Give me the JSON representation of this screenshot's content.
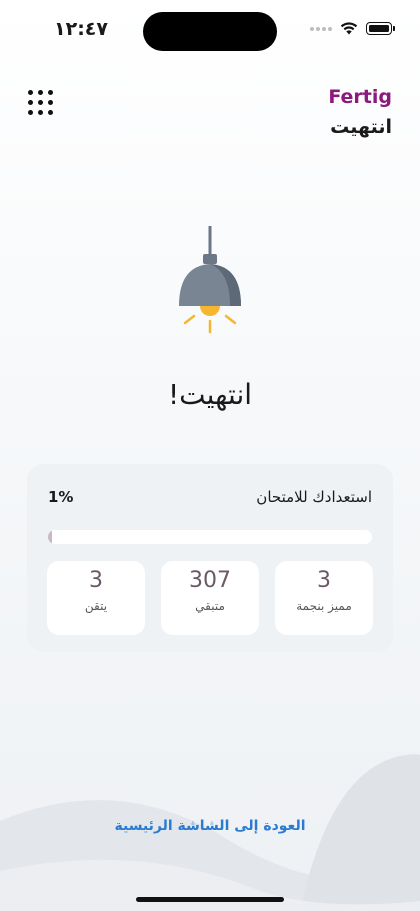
{
  "status_bar": {
    "time": "١٢:٤٧"
  },
  "header": {
    "brand": "Fertig",
    "title": "انتهيت"
  },
  "icons": {
    "menu": "grid-dots-icon",
    "illustration": "hanging-lamp-icon"
  },
  "main": {
    "title": "انتهيت!"
  },
  "readiness": {
    "label": "استعدادك للامتحان",
    "value_text": "1%",
    "progress": 0.01
  },
  "stats": [
    {
      "value": "3",
      "label": "مميز بنجمة"
    },
    {
      "value": "307",
      "label": "متبقي"
    },
    {
      "value": "3",
      "label": "يتقن"
    }
  ],
  "footer": {
    "home_link": "العودة إلى الشاشة الرئيسية"
  },
  "colors": {
    "brand": "#8b1a7c",
    "link": "#2a7bd1",
    "lamp": "#6b7787",
    "light": "#f5b731"
  }
}
